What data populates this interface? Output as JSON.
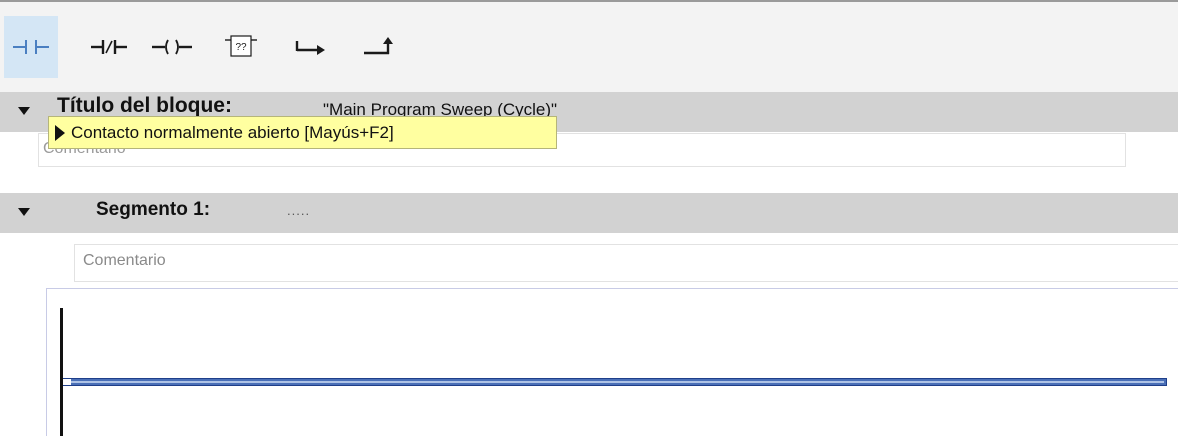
{
  "toolbar": {
    "buttons": [
      {
        "name": "normally-open-contact-icon",
        "active": true
      },
      {
        "name": "normally-closed-contact-icon",
        "active": false
      },
      {
        "name": "coil-icon",
        "active": false
      },
      {
        "name": "empty-box-icon",
        "active": false,
        "label": "??"
      },
      {
        "name": "open-branch-icon",
        "active": false
      },
      {
        "name": "close-branch-icon",
        "active": false
      }
    ],
    "accent_color": "#1f4f9a",
    "active_bg": "#d4e6f5"
  },
  "block": {
    "title_label": "Título del bloque:",
    "title_value": "\"Main Program Sweep (Cycle)\"",
    "comment_placeholder": "Comentario"
  },
  "tooltip": {
    "text": "Contacto normalmente abierto [Mayús+F2]"
  },
  "segment": {
    "label": "Segmento 1:",
    "title": ".....",
    "comment_placeholder": "Comentario"
  }
}
